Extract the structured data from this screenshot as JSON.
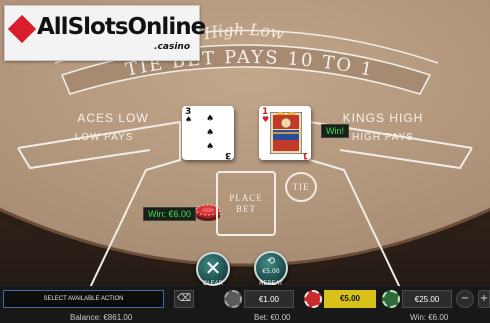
{
  "watermark": {
    "main": "AllSlotsOnline",
    "sub": ".casino"
  },
  "table": {
    "arc_title": "High Low",
    "banner": "TIE BET PAYS 10 TO 1",
    "left_area_title": "ACES LOW",
    "left_area_sub": "LOW PAYS",
    "right_area_title": "KINGS HIGH",
    "right_area_sub": "HIGH PAYS",
    "place_bet_line1": "PLACE",
    "place_bet_line2": "BET",
    "tie_label": "TIE"
  },
  "cards": {
    "left": {
      "rank": "3",
      "suit": "spades",
      "suit_symbol": "♠",
      "color": "#111111"
    },
    "right": {
      "rank": "1",
      "suit": "hearts",
      "suit_symbol": "♥",
      "color": "#d0202a",
      "face": "king"
    }
  },
  "labels": {
    "card_win": "Win!",
    "chip_win": "Win: €6.00"
  },
  "buttons": {
    "clear_label": "CLEAR",
    "repeat_label": "REPEAT",
    "repeat_amount": "€5.00"
  },
  "bottom_bar": {
    "status": "SELECT AVAILABLE ACTION",
    "chips": [
      {
        "value": "€1.00",
        "selected": false,
        "color": "#5a5a5a"
      },
      {
        "value": "€5.00",
        "selected": true,
        "color": "#d8c21a"
      },
      {
        "value": "€25.00",
        "selected": false,
        "color": "#2f6a3a"
      }
    ],
    "balance": "Balance: €861.00",
    "bet": "Bet: €0.00",
    "win": "Win: €6.00"
  },
  "colors": {
    "felt": "#b79a80",
    "wood": "#2e231c",
    "line": "#f1ede6",
    "accent_green": "#36e05a",
    "chip_yellow": "#d8c21a"
  }
}
